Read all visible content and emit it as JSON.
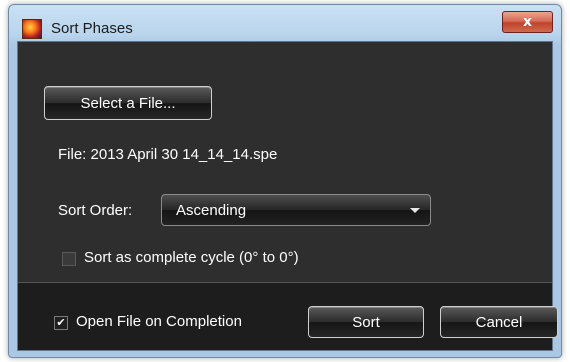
{
  "window": {
    "title": "Sort Phases",
    "close_label": "x",
    "app_icon": "app-icon"
  },
  "file_section": {
    "select_button_label": "Select a File...",
    "file_text": "File: 2013 April 30 14_14_14.spe"
  },
  "sort_order": {
    "label": "Sort Order:",
    "selected": "Ascending"
  },
  "cycle_option": {
    "label": "Sort as complete cycle (0° to 0°)",
    "checked": false
  },
  "footer": {
    "open_on_completion_label": "Open File on Completion",
    "open_on_completion_checked": true,
    "checkmark": "✔",
    "sort_label": "Sort",
    "cancel_label": "Cancel"
  },
  "colors": {
    "panel_background": "#2e2e2e",
    "footer_background": "#1d1d1d",
    "title_bar": "#b9d4ec",
    "close_button": "#c0432a"
  }
}
